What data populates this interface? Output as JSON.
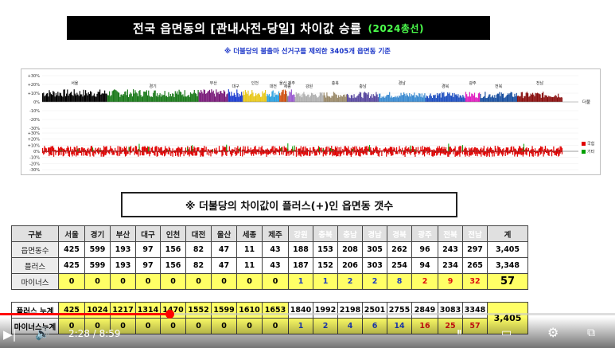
{
  "title": "전국 읍면동의 [관내사전-당일] 차이값 승률",
  "title_highlight": "(2024총선)",
  "subtitle": "※ 더불당의 불출마 선거구를 제외한 3405개 읍면동 기준",
  "chart_data": [
    {
      "type": "bar",
      "ylim": [
        -0.3,
        0.3
      ],
      "y_tick_labels": [
        "+30%",
        "+20%",
        "+10%",
        "0%",
        "-10%",
        "-20%",
        "-30%"
      ],
      "series_name": "더불",
      "regions": [
        "서울",
        "경기",
        "부산",
        "대구",
        "인천",
        "대전",
        "울산",
        "세종",
        "제주",
        "강원",
        "충북",
        "충남",
        "경남",
        "경북",
        "광주",
        "전북",
        "전남"
      ],
      "region_colors": [
        "#000000",
        "#1b7a1b",
        "#7a1b7a",
        "#1b3bd0",
        "#e8c81b",
        "#2aa0e0",
        "#d05010",
        "#808080",
        "#9a5ad0",
        "#b0b0b0",
        "#9a8a6a",
        "#5a4aa0",
        "#3a8ad0",
        "#2050c0",
        "#e020c0",
        "#1a50a0",
        "#8a1010"
      ]
    },
    {
      "type": "bar",
      "ylim": [
        -0.3,
        0.3
      ],
      "y_tick_labels": [
        "+30%",
        "+20%",
        "+10%",
        "0%",
        "-10%",
        "-20%",
        "-30%"
      ],
      "legend": [
        "국힘",
        "기타"
      ],
      "legend_colors": [
        "#e00000",
        "#00a000"
      ]
    }
  ],
  "box_title": "※ 더불당의 차이값이 플러스(+)인 읍면동 갯수",
  "table": {
    "header_label": "구분",
    "columns": [
      "서울",
      "경기",
      "부산",
      "대구",
      "인천",
      "대전",
      "울산",
      "세종",
      "제주",
      "강원",
      "충북",
      "충남",
      "경남",
      "경북",
      "광주",
      "전북",
      "전남"
    ],
    "total_label": "계",
    "rows": [
      {
        "label": "읍면동수",
        "values": [
          "425",
          "599",
          "193",
          "97",
          "156",
          "82",
          "47",
          "11",
          "43",
          "188",
          "153",
          "208",
          "305",
          "262",
          "96",
          "243",
          "297"
        ],
        "total": "3,405"
      },
      {
        "label": "플러스",
        "values": [
          "425",
          "599",
          "193",
          "97",
          "156",
          "82",
          "47",
          "11",
          "43",
          "187",
          "152",
          "206",
          "303",
          "254",
          "94",
          "234",
          "265"
        ],
        "total": "3,348"
      },
      {
        "label": "마이너스",
        "values": [
          "0",
          "0",
          "0",
          "0",
          "0",
          "0",
          "0",
          "0",
          "0",
          "1",
          "1",
          "2",
          "2",
          "8",
          "2",
          "9",
          "32"
        ],
        "total": "57"
      }
    ]
  },
  "table2": {
    "rows": [
      {
        "label": "플러스 누계",
        "values": [
          "425",
          "1024",
          "1217",
          "1314",
          "1470",
          "1552",
          "1599",
          "1610",
          "1653",
          "1840",
          "1992",
          "2198",
          "2501",
          "2755",
          "2849",
          "3083",
          "3348"
        ]
      },
      {
        "label": "마이너스누계",
        "values": [
          "0",
          "0",
          "0",
          "0",
          "0",
          "0",
          "0",
          "0",
          "0",
          "1",
          "2",
          "4",
          "6",
          "14",
          "16",
          "25",
          "57"
        ]
      }
    ],
    "total": "3,405"
  },
  "player": {
    "time": "2:28 / 8:59",
    "progress": 0.275
  }
}
